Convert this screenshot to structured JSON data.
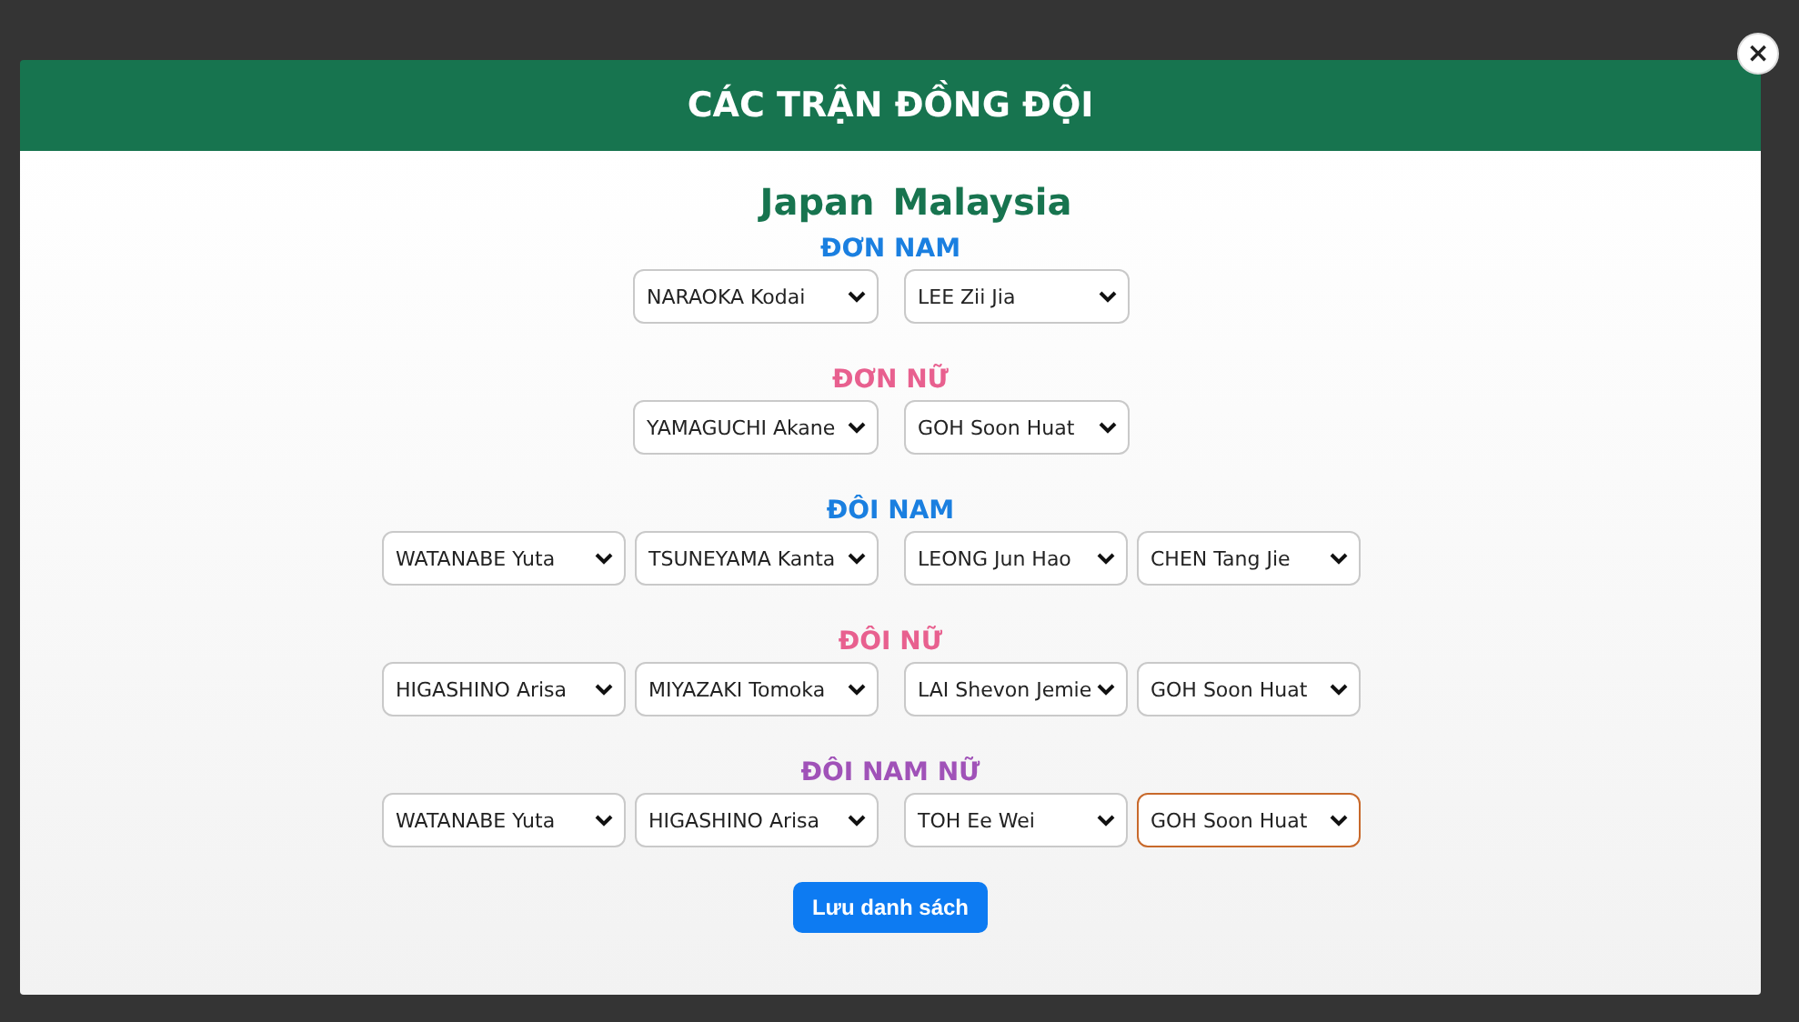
{
  "dialog": {
    "title": "CÁC TRẬN ĐỒNG ĐỘI",
    "close": "×",
    "teams": [
      "Japan",
      "Malaysia"
    ],
    "matches": [
      {
        "label": "ĐƠN NAM",
        "color": "#1a7fe0",
        "home": [
          {
            "value": "NARAOKA Kodai",
            "focused": false
          }
        ],
        "away": [
          {
            "value": "LEE Zii Jia",
            "focused": false
          }
        ]
      },
      {
        "label": "ĐƠN NỮ",
        "color": "#e8608f",
        "home": [
          {
            "value": "YAMAGUCHI Akane",
            "focused": false
          }
        ],
        "away": [
          {
            "value": "GOH Soon Huat",
            "focused": false
          }
        ]
      },
      {
        "label": "ĐÔI NAM",
        "color": "#1a7fe0",
        "home": [
          {
            "value": "WATANABE Yuta",
            "focused": false
          },
          {
            "value": "TSUNEYAMA Kanta",
            "focused": false
          }
        ],
        "away": [
          {
            "value": "LEONG Jun Hao",
            "focused": false
          },
          {
            "value": "CHEN Tang Jie",
            "focused": false
          }
        ]
      },
      {
        "label": "ĐÔI NỮ",
        "color": "#e8608f",
        "home": [
          {
            "value": "HIGASHINO Arisa",
            "focused": false
          },
          {
            "value": "MIYAZAKI Tomoka",
            "focused": false
          }
        ],
        "away": [
          {
            "value": "LAI Shevon Jemie",
            "focused": false
          },
          {
            "value": "GOH Soon Huat",
            "focused": false
          }
        ]
      },
      {
        "label": "ĐÔI NAM NỮ",
        "color": "#a052b8",
        "home": [
          {
            "value": "WATANABE Yuta",
            "focused": false
          },
          {
            "value": "HIGASHINO Arisa",
            "focused": false
          }
        ],
        "away": [
          {
            "value": "TOH Ee Wei",
            "focused": false
          },
          {
            "value": "GOH Soon Huat",
            "focused": true
          }
        ]
      }
    ],
    "save_button": "Lưu danh sách"
  }
}
